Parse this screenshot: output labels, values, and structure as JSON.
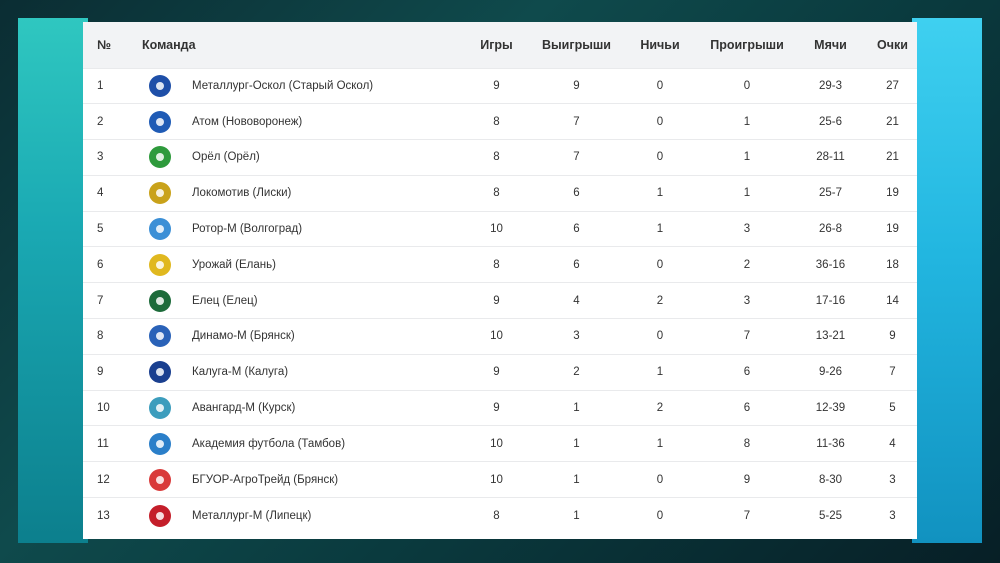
{
  "table": {
    "headers": {
      "num": "№",
      "team": "Команда",
      "games": "Игры",
      "wins": "Выигрыши",
      "draws": "Ничьи",
      "losses": "Проигрыши",
      "goals": "Мячи",
      "points": "Очки"
    },
    "rows": [
      {
        "num": "1",
        "team": "Металлург-Оскол (Старый Оскол)",
        "games": "9",
        "wins": "9",
        "draws": "0",
        "losses": "0",
        "goals": "29-3",
        "points": "27",
        "logo_color": "#1e4fa8"
      },
      {
        "num": "2",
        "team": "Атом (Нововоронеж)",
        "games": "8",
        "wins": "7",
        "draws": "0",
        "losses": "1",
        "goals": "25-6",
        "points": "21",
        "logo_color": "#1f5bb5"
      },
      {
        "num": "3",
        "team": "Орёл (Орёл)",
        "games": "8",
        "wins": "7",
        "draws": "0",
        "losses": "1",
        "goals": "28-11",
        "points": "21",
        "logo_color": "#2e9a3c"
      },
      {
        "num": "4",
        "team": "Локомотив (Лиски)",
        "games": "8",
        "wins": "6",
        "draws": "1",
        "losses": "1",
        "goals": "25-7",
        "points": "19",
        "logo_color": "#c9a21a"
      },
      {
        "num": "5",
        "team": "Ротор-М (Волгоград)",
        "games": "10",
        "wins": "6",
        "draws": "1",
        "losses": "3",
        "goals": "26-8",
        "points": "19",
        "logo_color": "#3b8fd6"
      },
      {
        "num": "6",
        "team": "Урожай (Елань)",
        "games": "8",
        "wins": "6",
        "draws": "0",
        "losses": "2",
        "goals": "36-16",
        "points": "18",
        "logo_color": "#e0b81f"
      },
      {
        "num": "7",
        "team": "Елец (Елец)",
        "games": "9",
        "wins": "4",
        "draws": "2",
        "losses": "3",
        "goals": "17-16",
        "points": "14",
        "logo_color": "#1d6b3a"
      },
      {
        "num": "8",
        "team": "Динамо-М (Брянск)",
        "games": "10",
        "wins": "3",
        "draws": "0",
        "losses": "7",
        "goals": "13-21",
        "points": "9",
        "logo_color": "#2a62b8"
      },
      {
        "num": "9",
        "team": "Калуга-М (Калуга)",
        "games": "9",
        "wins": "2",
        "draws": "1",
        "losses": "6",
        "goals": "9-26",
        "points": "7",
        "logo_color": "#1a3f8f"
      },
      {
        "num": "10",
        "team": "Авангард-М (Курск)",
        "games": "9",
        "wins": "1",
        "draws": "2",
        "losses": "6",
        "goals": "12-39",
        "points": "5",
        "logo_color": "#3c9dbd"
      },
      {
        "num": "11",
        "team": "Академия футбола (Тамбов)",
        "games": "10",
        "wins": "1",
        "draws": "1",
        "losses": "8",
        "goals": "11-36",
        "points": "4",
        "logo_color": "#2b7fc9"
      },
      {
        "num": "12",
        "team": "БГУОР-АгроТрейд (Брянск)",
        "games": "10",
        "wins": "1",
        "draws": "0",
        "losses": "9",
        "goals": "8-30",
        "points": "3",
        "logo_color": "#d93a3a"
      },
      {
        "num": "13",
        "team": "Металлург-М (Липецк)",
        "games": "8",
        "wins": "1",
        "draws": "0",
        "losses": "7",
        "goals": "5-25",
        "points": "3",
        "logo_color": "#c41e2a"
      }
    ]
  }
}
